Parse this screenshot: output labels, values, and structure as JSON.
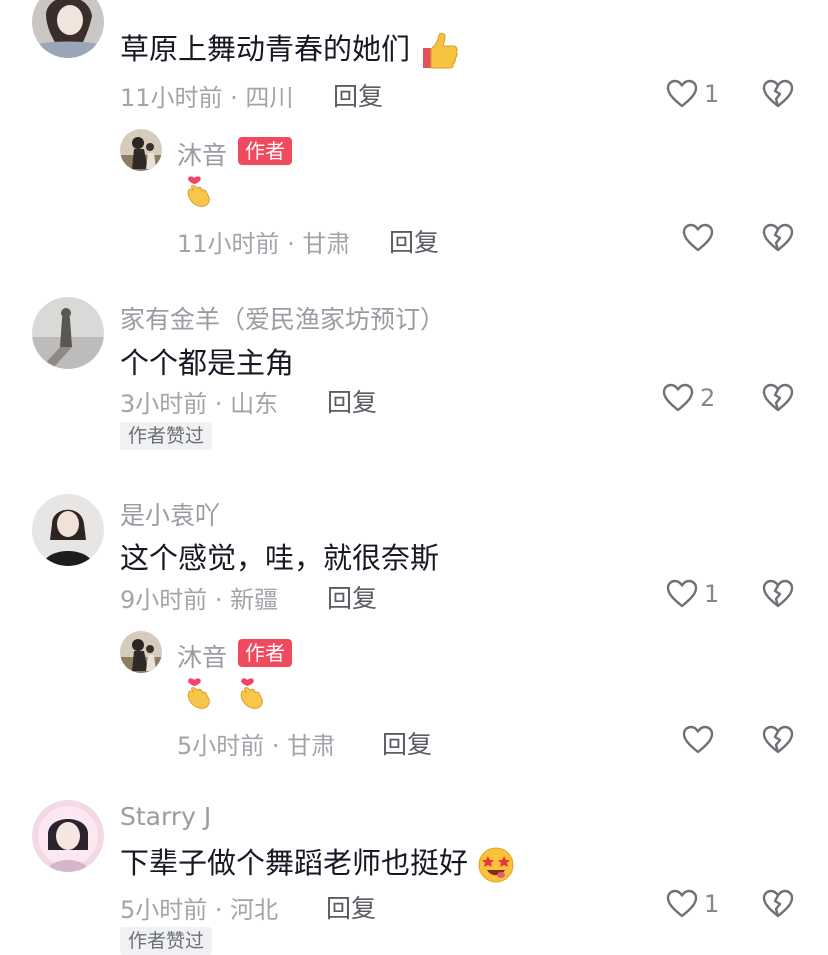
{
  "comments": [
    {
      "name": "",
      "text": "草原上舞动青春的她们",
      "time": "11小时前 · 四川",
      "reply": "回复",
      "likes": "1",
      "replies": [
        {
          "name": "沐音",
          "badge": "作者",
          "text": "",
          "time": "11小时前 · 甘肃",
          "reply": "回复",
          "likes": ""
        }
      ]
    },
    {
      "name": "家有金羊（爱民渔家坊预订）",
      "text": "个个都是主角",
      "time": "3小时前 · 山东",
      "reply": "回复",
      "likes": "2",
      "tag": "作者赞过"
    },
    {
      "name": "是小袁吖",
      "text": "这个感觉，哇，就很奈斯",
      "time": "9小时前 · 新疆",
      "reply": "回复",
      "likes": "1",
      "replies": [
        {
          "name": "沐音",
          "badge": "作者",
          "text": "",
          "time": "5小时前 · 甘肃",
          "reply": "回复",
          "likes": ""
        }
      ]
    },
    {
      "name": "Starry J",
      "text": "下辈子做个舞蹈老师也挺好",
      "time": "5小时前 · 河北",
      "reply": "回复",
      "likes": "1",
      "tag": "作者赞过"
    }
  ],
  "icons": {
    "like": "heart-outline-icon",
    "dislike": "broken-heart-icon",
    "emoji_thumb": "thumbs-up-emoji",
    "emoji_heart": "finger-heart-emoji",
    "emoji_star": "star-struck-emoji"
  },
  "colors": {
    "badge": "#f04a5e",
    "text": "#161823",
    "meta": "#a2a4aa"
  }
}
